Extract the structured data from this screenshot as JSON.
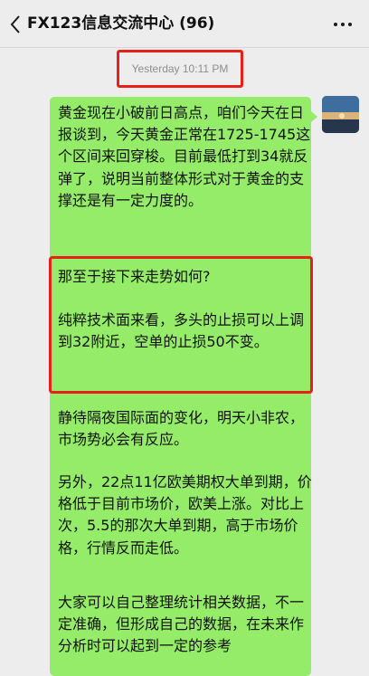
{
  "header": {
    "back_icon": "chevron-left-icon",
    "title": "FX123信息交流中心 (96)",
    "more_icon": "ellipsis-icon"
  },
  "chat": {
    "timestamp": "Yesterday 10:11 PM",
    "message": {
      "paragraphs": [
        "黄金现在小破前日高点，咱们今天在日报谈到，今天黄金正常在1725-1745这个区间来回穿梭。目前最低打到34就反弹了，说明当前整体形式对于黄金的支撑还是有一定力度的。",
        "那至于接下来走势如何?",
        "纯粹技术面来看，多头的止损可以上调到32附近，空单的止损50不变。",
        "静待隔夜国际面的变化，明天小非农，市场势必会有反应。",
        "另外，22点11亿欧美期权大单到期，价格低于目前市场价，欧美上涨。对比上次，5.5的那次大单到期，高于市场价格，行情反而走低。",
        "大家可以自己整理统计相关数据，不一定准确，但形成自己的数据，在未来作分析时可以起到一定的参考"
      ]
    }
  },
  "colors": {
    "background": "#ededed",
    "bubble": "#95ec69",
    "highlight": "#e8201a"
  }
}
